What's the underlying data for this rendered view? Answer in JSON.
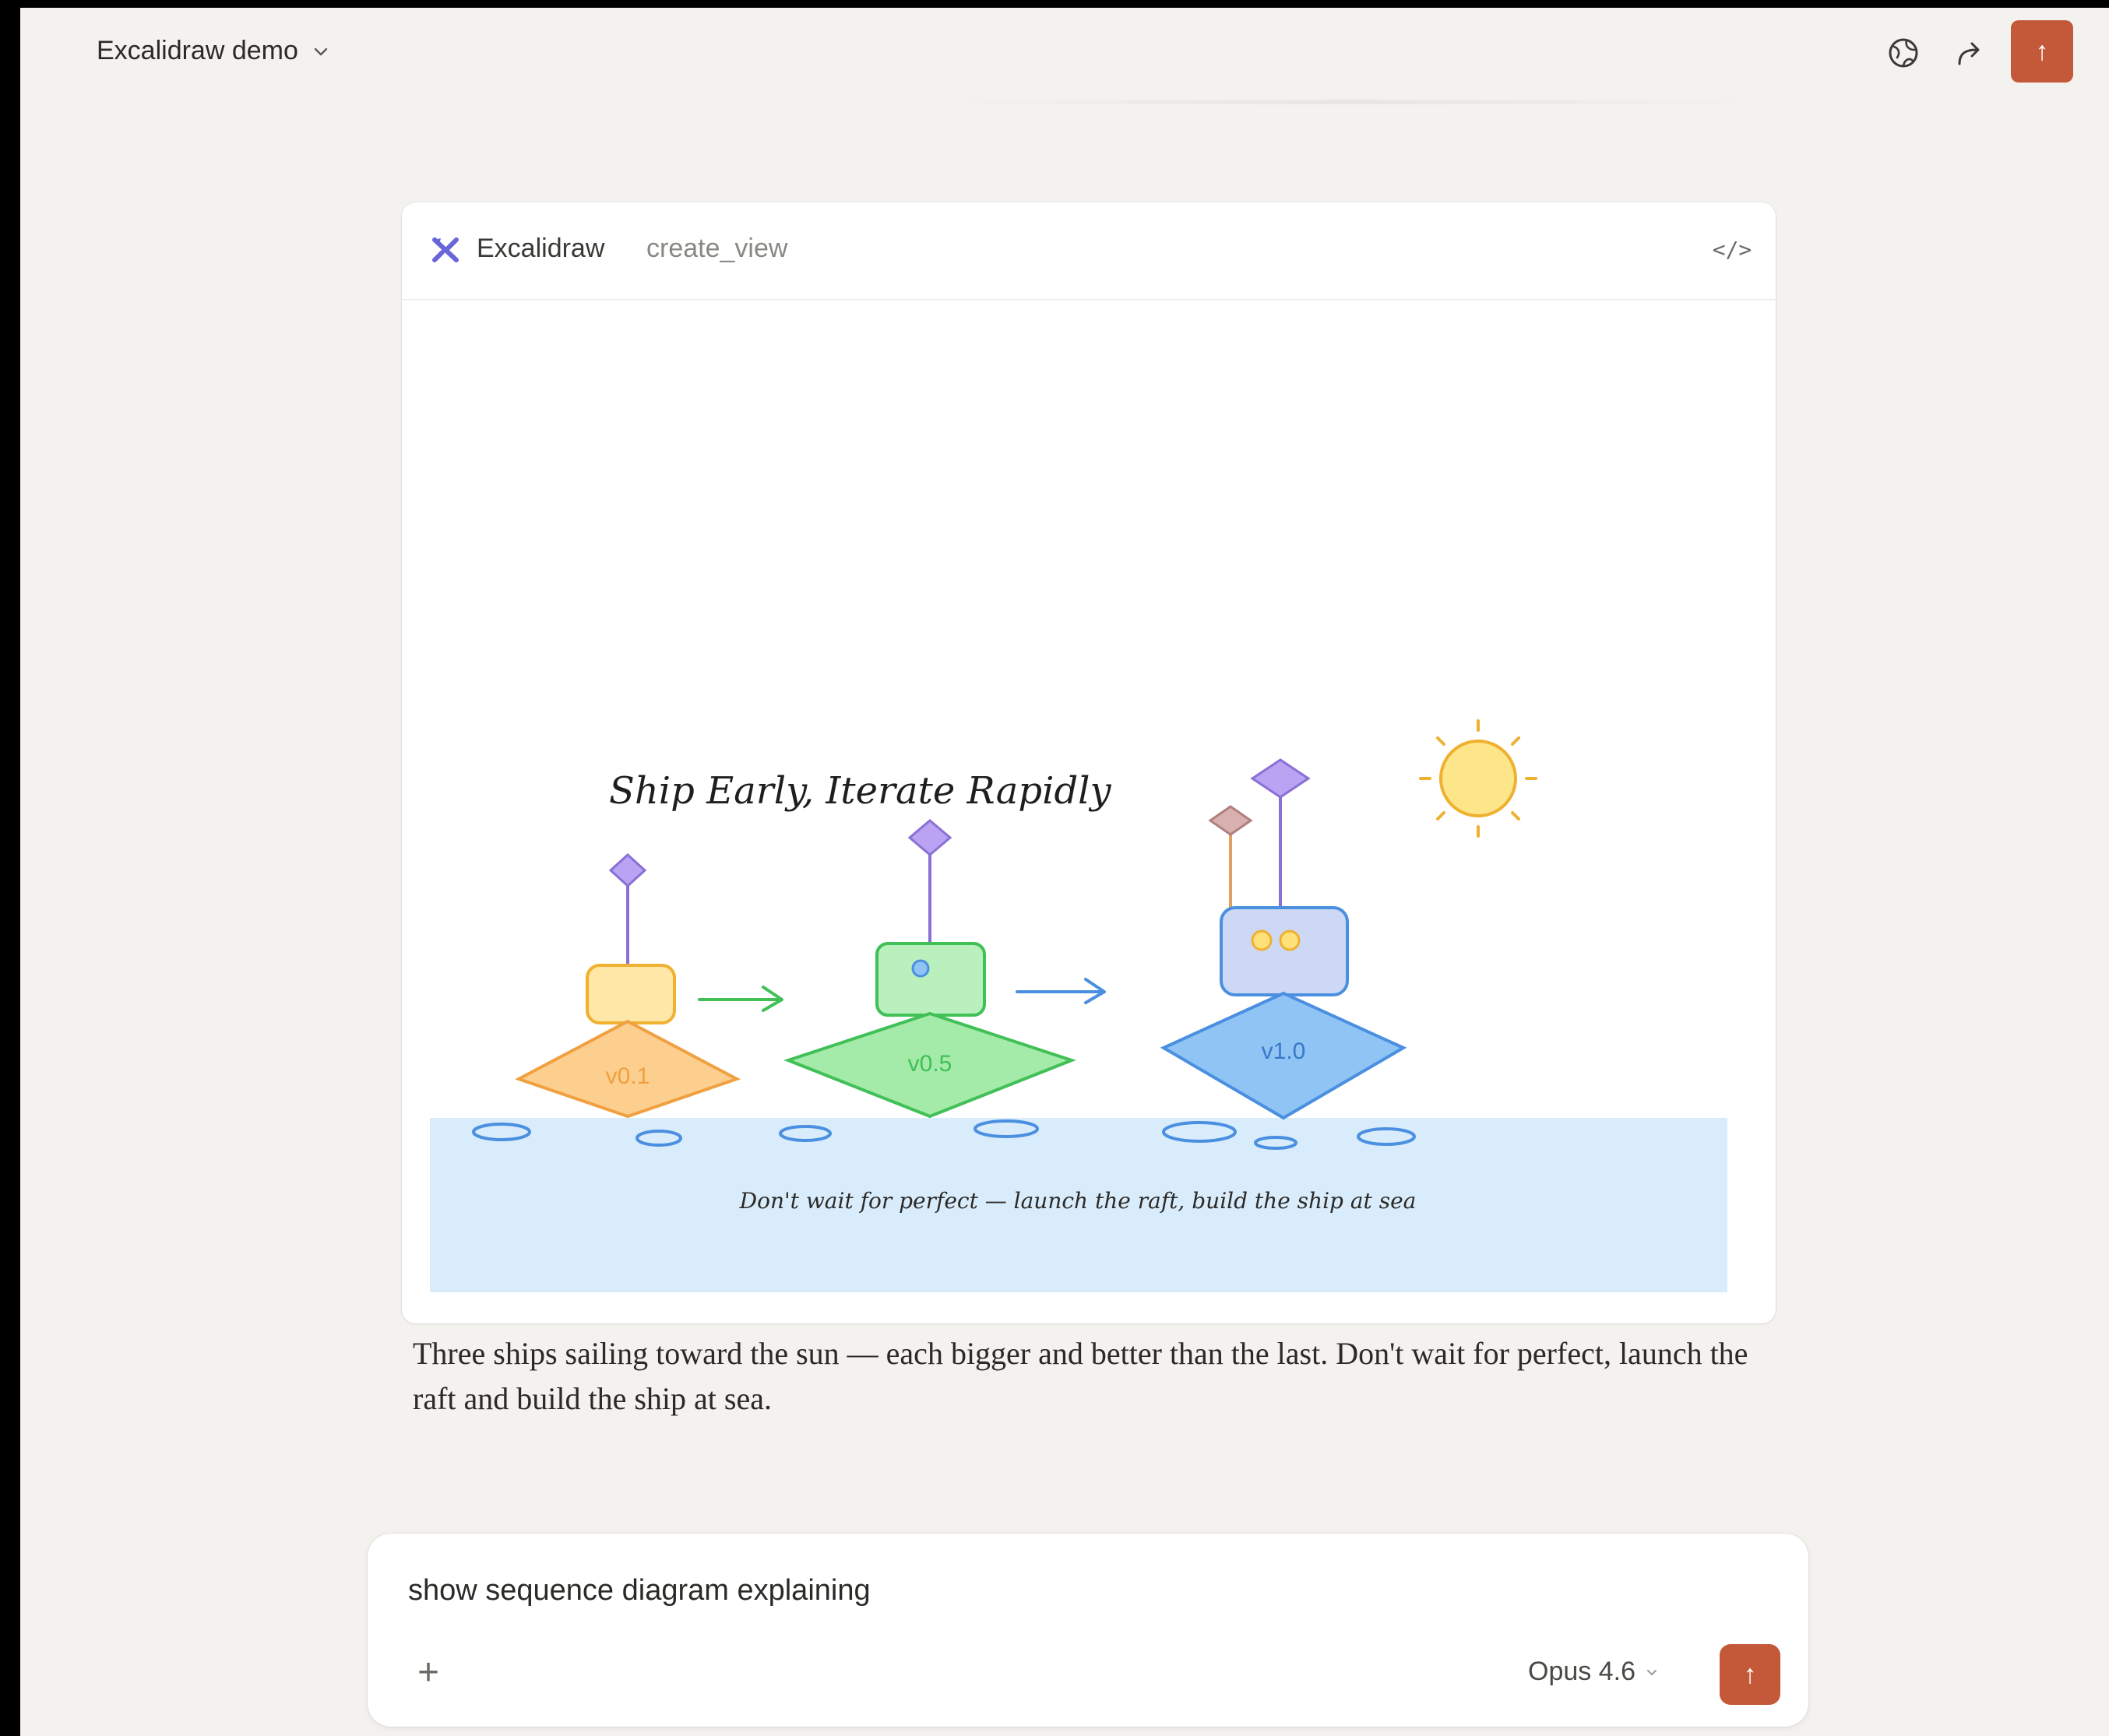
{
  "header": {
    "title": "Excalidraw demo",
    "icons": [
      "globe-icon",
      "share-icon"
    ],
    "action_glyph": "↑"
  },
  "colors": {
    "accent": "#c4593a",
    "background": "#f4f2ee",
    "card": "#ffffff",
    "sea": "#d9ecfb",
    "ship_v01": "#fdcf8f",
    "ship_v05": "#a4eaa8",
    "ship_v10": "#8fc4f5",
    "flag": "#b9a3f2",
    "sun": "#fde58a"
  },
  "artifact": {
    "tool_name": "Excalidraw",
    "function_name": "create_view",
    "code_toggle": "</>",
    "drawing": {
      "title": "Ship Early, Iterate Rapidly",
      "ships": [
        {
          "label": "v0.1"
        },
        {
          "label": "v0.5"
        },
        {
          "label": "v1.0"
        }
      ],
      "caption": "Don't wait for perfect — launch the raft, build the ship at sea"
    }
  },
  "message": {
    "text": "Three ships sailing toward the sun — each bigger and better than the last. Don't wait for perfect, launch the raft and build the ship at sea."
  },
  "composer": {
    "input_value": "show sequence diagram explaining",
    "plus_label": "+",
    "model": "Opus 4.6",
    "send_glyph": "↑"
  }
}
